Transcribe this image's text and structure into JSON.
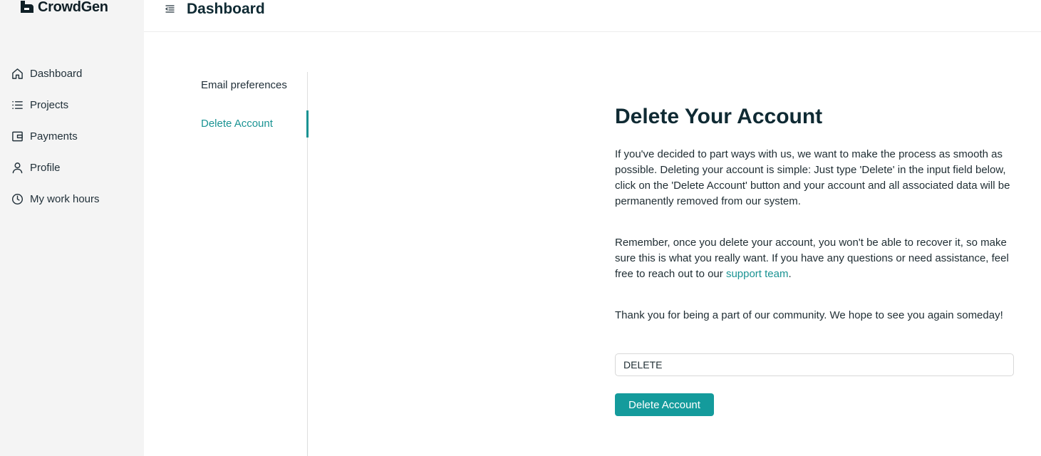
{
  "brand": {
    "name": "CrowdGen",
    "accent_color": "#1a9393"
  },
  "header": {
    "title": "Dashboard",
    "menu_icon": "menu-collapse-icon"
  },
  "sidebar": {
    "items": [
      {
        "label": "Dashboard",
        "icon": "home-icon"
      },
      {
        "label": "Projects",
        "icon": "list-icon"
      },
      {
        "label": "Payments",
        "icon": "wallet-icon"
      },
      {
        "label": "Profile",
        "icon": "user-icon"
      },
      {
        "label": "My work hours",
        "icon": "clock-icon"
      }
    ]
  },
  "settings_nav": {
    "items": [
      {
        "label": "Email preferences",
        "active": false
      },
      {
        "label": "Delete Account",
        "active": true
      }
    ]
  },
  "main": {
    "heading": "Delete Your Account",
    "paragraph1": "If you've decided to part ways with us, we want to make the process as smooth as possible. Deleting your account is simple: Just type 'Delete' in the input field below, click on the 'Delete Account' button and your account and all associated data will be permanently removed from our system.",
    "paragraph2_before": "Remember, once you delete your account, you won't be able to recover it, so make sure this is what you really want. If you have any questions or need assistance, feel free to reach out to our ",
    "paragraph2_link": "support team",
    "paragraph2_after": ".",
    "paragraph3": "Thank you for being a part of our community. We hope to see you again someday!",
    "confirm_input": {
      "value": "DELETE",
      "placeholder": ""
    },
    "delete_button": "Delete Account"
  }
}
